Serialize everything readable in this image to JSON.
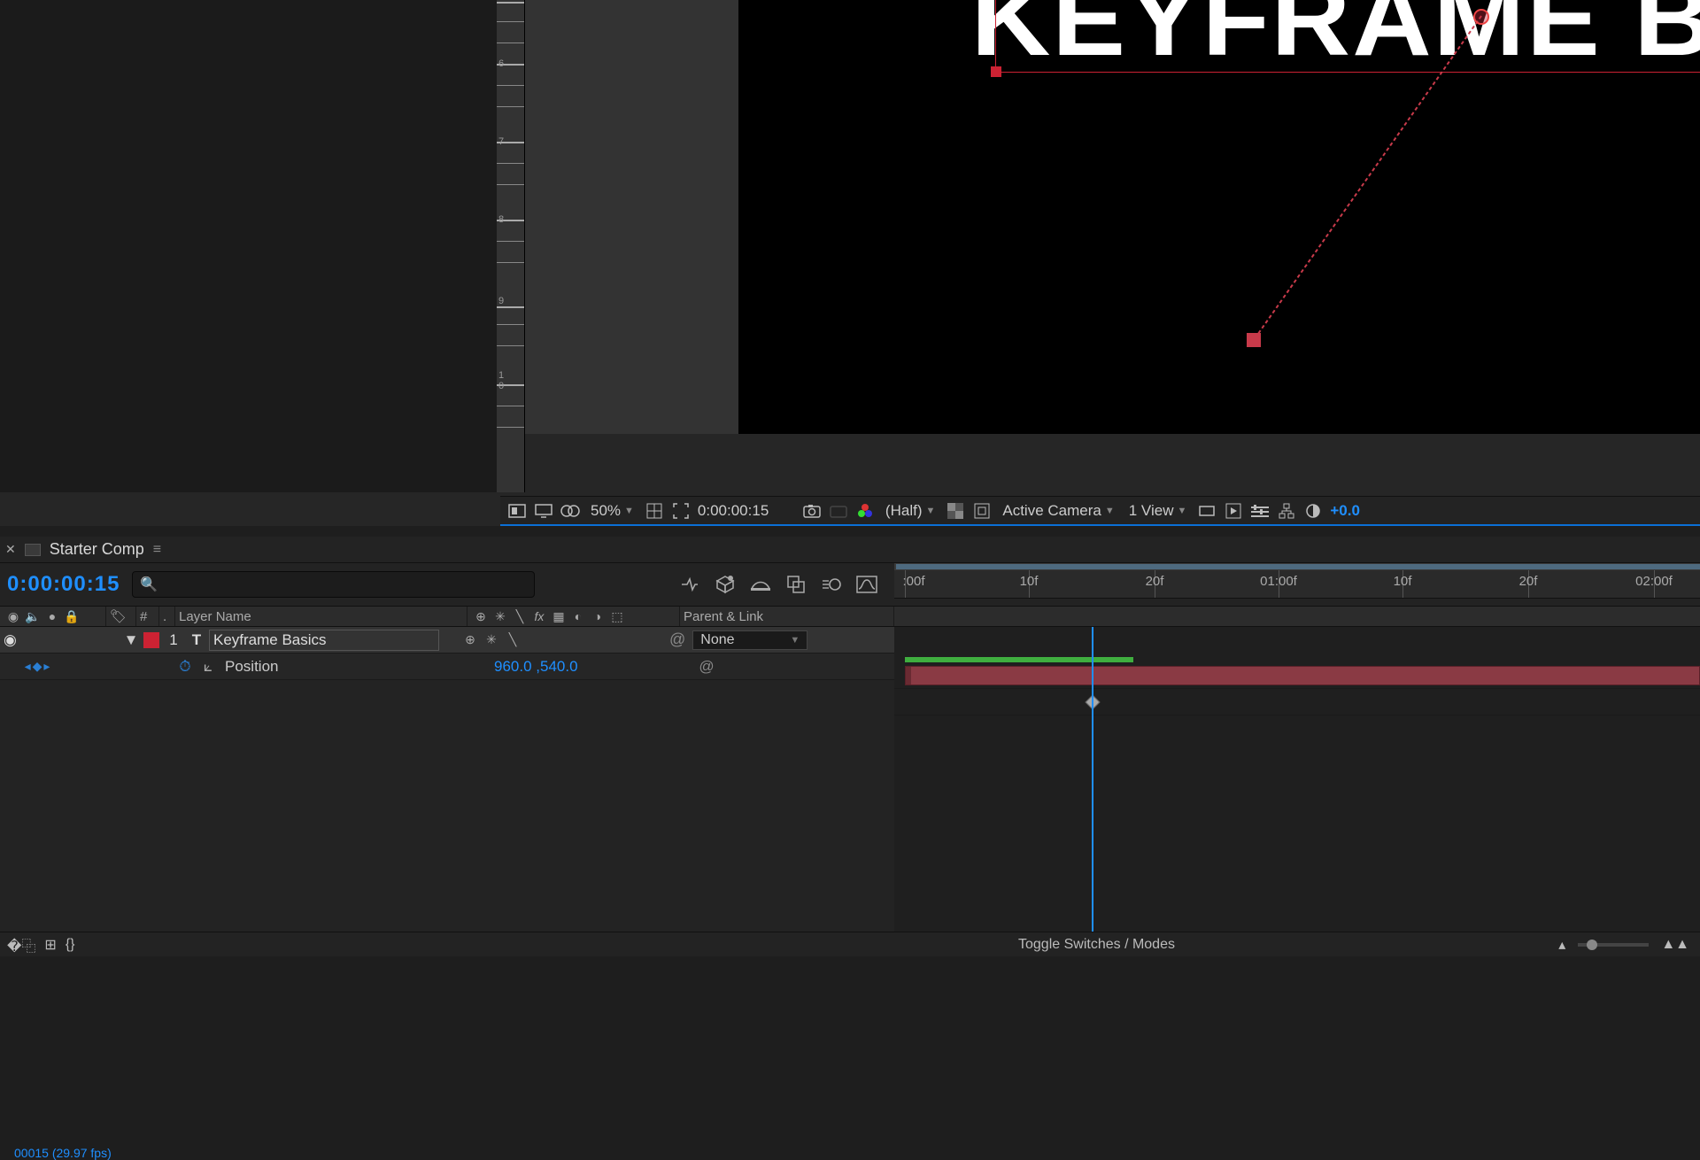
{
  "viewer": {
    "title_text": "KEYFRAME BA",
    "timecode": "0:00:00:15",
    "zoom": "50%",
    "resolution": "(Half)",
    "camera": "Active Camera",
    "view_count": "1 View",
    "exposure": "+0.0"
  },
  "timeline": {
    "tab_name": "Starter Comp",
    "timecode": "0:00:00:15",
    "frames_line": "00015 (29.97 fps)",
    "columns": {
      "layer_name": "Layer Name",
      "parent": "Parent & Link",
      "num": "#"
    },
    "layer": {
      "index": "1",
      "type_glyph": "T",
      "name": "Keyframe Basics",
      "parent": "None"
    },
    "property": {
      "name": "Position",
      "value": "960.0 ,540.0"
    },
    "ruler_labels": [
      ":00f",
      "10f",
      "20f",
      "01:00f",
      "10f",
      "20f",
      "02:00f"
    ],
    "footer_toggle": "Toggle Switches / Modes"
  },
  "colors": {
    "accent": "#1f8fff",
    "layer_color": "#c23a44",
    "render_bar": "#3fae3f"
  }
}
